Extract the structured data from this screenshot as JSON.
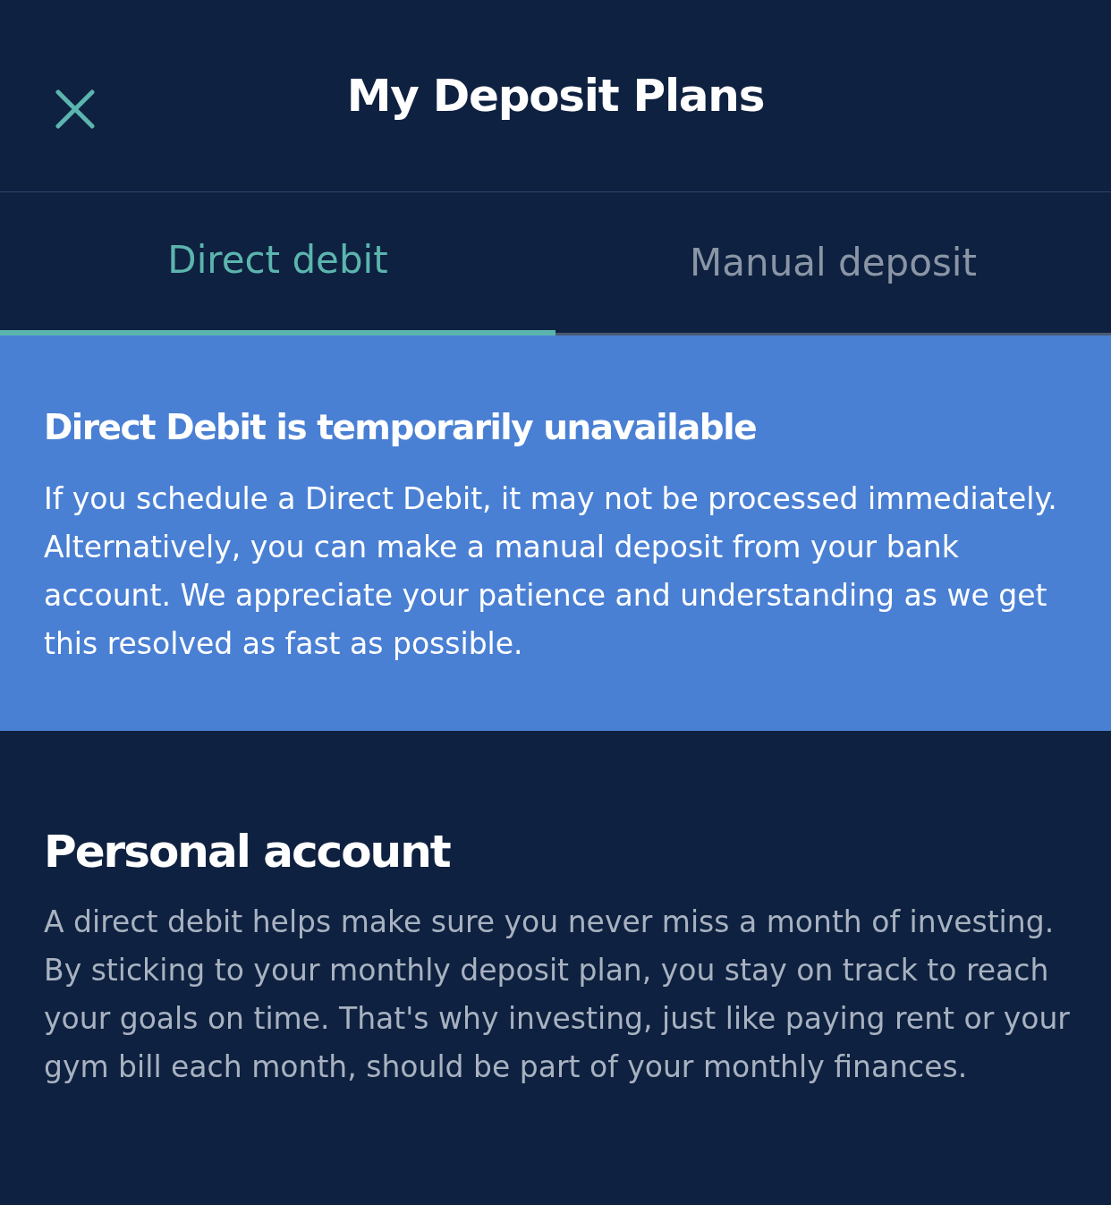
{
  "header": {
    "title": "My Deposit Plans"
  },
  "tabs": [
    {
      "label": "Direct debit",
      "selected": true
    },
    {
      "label": "Manual deposit",
      "selected": false
    }
  ],
  "notice": {
    "title": "Direct Debit is temporarily unavailable",
    "body": "If you schedule a Direct Debit, it may not be processed immediately. Alternatively, you can make a manual deposit from your bank account. We appreciate your patience and understanding as we get this resolved as fast as possible."
  },
  "section": {
    "title": "Personal account",
    "body": "A direct debit helps make sure you never miss a month of investing. By sticking to your monthly deposit plan, you stay on track to reach your goals on time. That's why investing, just like paying rent or your gym bill each month, should be part of your monthly finances."
  }
}
